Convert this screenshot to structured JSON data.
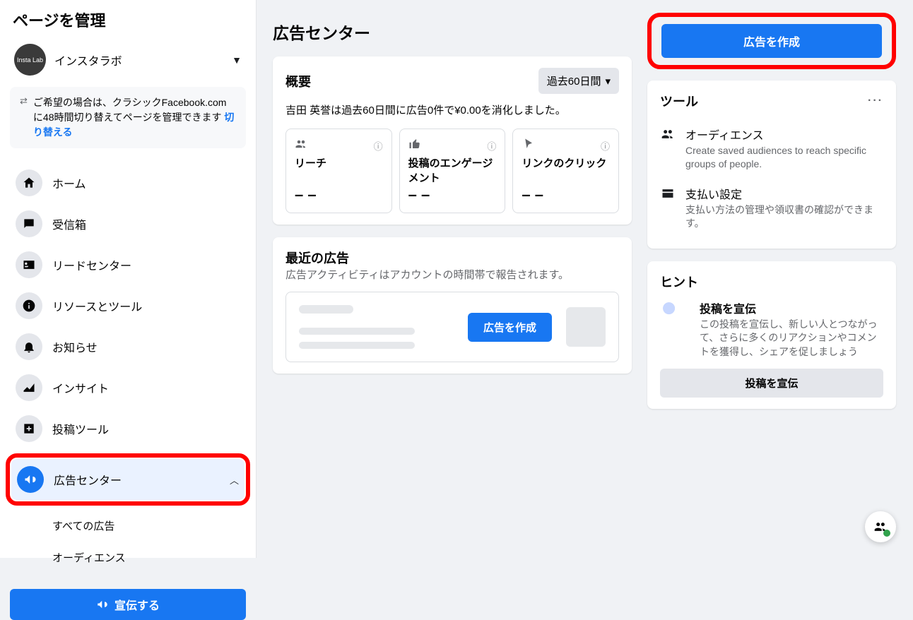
{
  "sidebar": {
    "title": "ページを管理",
    "page_name": "インスタラボ",
    "avatar_label": "Insta Lab",
    "notice_text_1": "ご希望の場合は、クラシックFacebook.comに48時間切り替えてページを管理できます",
    "notice_link": "切り替える",
    "items": [
      {
        "label": "ホーム"
      },
      {
        "label": "受信箱"
      },
      {
        "label": "リードセンター"
      },
      {
        "label": "リソースとツール"
      },
      {
        "label": "お知らせ"
      },
      {
        "label": "インサイト"
      },
      {
        "label": "投稿ツール"
      },
      {
        "label": "広告センター"
      }
    ],
    "subitems": [
      {
        "label": "すべての広告"
      },
      {
        "label": "オーディエンス"
      }
    ],
    "promote_label": "宣伝する"
  },
  "main": {
    "title": "広告センター",
    "overview": {
      "title": "概要",
      "range_label": "過去60日間",
      "summary_text": "吉田 英誉は過去60日間に広告0件で¥0.00を消化しました。",
      "metrics": [
        {
          "label": "リーチ",
          "value": "– –"
        },
        {
          "label": "投稿のエンゲージメント",
          "value": "– –"
        },
        {
          "label": "リンクのクリック",
          "value": "– –"
        }
      ]
    },
    "recent": {
      "title": "最近の広告",
      "subtext": "広告アクティビティはアカウントの時間帯で報告されます。",
      "create_label": "広告を作成"
    }
  },
  "right": {
    "create_ad": "広告を作成",
    "tools": {
      "title": "ツール",
      "items": [
        {
          "title": "オーディエンス",
          "desc": "Create saved audiences to reach specific groups of people."
        },
        {
          "title": "支払い設定",
          "desc": "支払い方法の管理や領収書の確認ができます。"
        }
      ]
    },
    "hint": {
      "title": "ヒント",
      "item_title": "投稿を宣伝",
      "item_desc": "この投稿を宣伝し、新しい人とつながって、さらに多くのリアクションやコメントを獲得し、シェアを促しましょう",
      "button": "投稿を宣伝"
    }
  }
}
